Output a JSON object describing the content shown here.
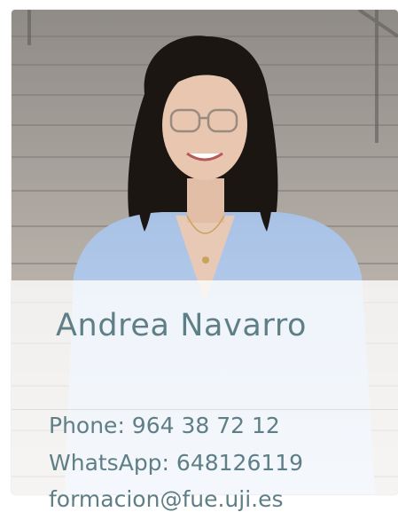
{
  "profile": {
    "name": "Andrea Navarro",
    "phone": "Phone: 964 38 72 12",
    "whatsapp": "WhatsApp: 648126119",
    "email": "formacion@fue.uji.es"
  }
}
